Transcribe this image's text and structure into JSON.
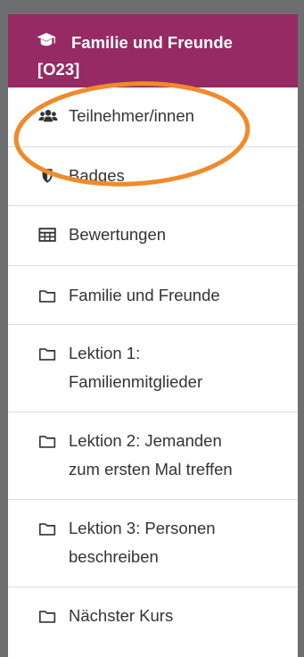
{
  "course": {
    "title_line1": "Familie und Freunde",
    "title_line2": "[O23]",
    "icon": "graduation-cap-icon"
  },
  "nav_items": [
    {
      "label": "Teilnehmer/innen",
      "icon": "users-icon"
    },
    {
      "label": "Badges",
      "icon": "shield-icon"
    },
    {
      "label": "Bewertungen",
      "icon": "table-icon"
    },
    {
      "label": "Familie und Freunde",
      "icon": "folder-icon"
    },
    {
      "label_line1": "Lektion 1:",
      "label_line2": "Familienmitglieder",
      "icon": "folder-icon"
    },
    {
      "label_line1": "Lektion 2: Jemanden",
      "label_line2": "zum ersten Mal treffen",
      "icon": "folder-icon"
    },
    {
      "label_line1": "Lektion 3: Personen",
      "label_line2": "beschreiben",
      "icon": "folder-icon"
    },
    {
      "label": "Nächster Kurs",
      "icon": "folder-icon"
    }
  ],
  "colors": {
    "header_bg": "#962a64",
    "highlight": "#f08a2c",
    "text": "#333333"
  }
}
